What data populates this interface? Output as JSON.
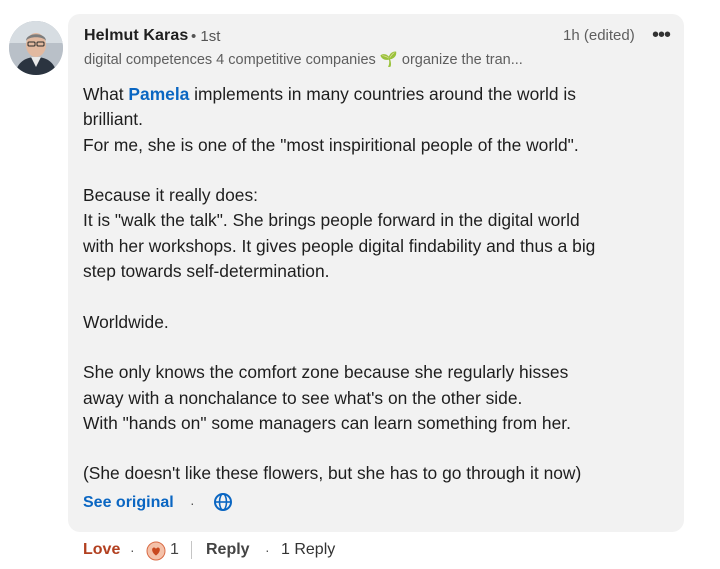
{
  "comment": {
    "author_name": "Helmut Karas",
    "degree": "• 1st",
    "time": "1h (edited)",
    "more_icon": "•••",
    "headline_part1": "digital competences 4 competitive companies",
    "sprout_icon": "🌱",
    "headline_part2": "organize the tran...",
    "body": {
      "l1_pre": "What ",
      "mention": "Pamela",
      "l1_post": " implements in many countries around the world is",
      "l2": "brilliant.",
      "l3": "For me, she is one of the \"most inspiritional people of the world\".",
      "l4": "Because it really does:",
      "l5": "It is \"walk the talk\". She brings people forward in the digital world",
      "l6": "with her workshops. It gives people digital findability and thus a big",
      "l7": "step towards self-determination.",
      "l8": "Worldwide.",
      "l9": "She only knows the comfort zone because she regularly hisses",
      "l10": "away with a nonchalance to see what's on the other side.",
      "l11": "With \"hands on\" some managers can learn something from her.",
      "l12": "(She doesn't like these flowers, but she has to go through it now)"
    },
    "see_original": "See original",
    "separator": "·",
    "translate_icon": "globe-icon"
  },
  "actions": {
    "love": "Love",
    "separator": "·",
    "reaction_count": "1",
    "reply": "Reply",
    "reply_count": "1 Reply"
  },
  "colors": {
    "link": "#0a66c2",
    "love": "#b24020",
    "bubble": "#f2f2f2"
  }
}
